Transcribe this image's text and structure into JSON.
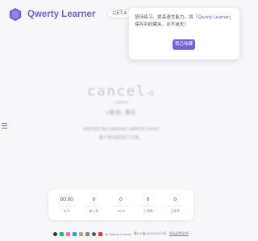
{
  "brand": {
    "name": "Qwerty Learner",
    "color": "#6f63d9"
  },
  "dictionary": {
    "label": "CET-4"
  },
  "popup": {
    "text_before": "坚持练习，提高语言能力。将",
    "text_highlight": "「Qwerty Learner」",
    "text_after": "保存到收藏夹，永不迷失！",
    "button_label": "我已收藏"
  },
  "word": {
    "text": "cancel",
    "speaker_icon": "speaker-icon",
    "phonetic": "/ˈkænsl/",
    "translation": "v.取消；删去",
    "sentence": "example the customer called to cancel",
    "sentence_translation": "客户来电取消了订单。"
  },
  "stats": [
    {
      "value": "00:00",
      "label": "时间"
    },
    {
      "value": "0",
      "label": "输入数"
    },
    {
      "value": "0",
      "label": "WPM"
    },
    {
      "value": "0",
      "label": "正确数"
    },
    {
      "value": "0",
      "label": "正确率"
    }
  ],
  "footer": {
    "icons": [
      "github-icon",
      "wechat-icon",
      "bilibili-icon",
      "twitter-icon",
      "coffee-icon",
      "mail-icon",
      "info-icon",
      "flag-icon"
    ],
    "credit": "@ Qwerty Learner",
    "icp": "豫ICP备2022004978号",
    "link": "隐私政策说明"
  }
}
